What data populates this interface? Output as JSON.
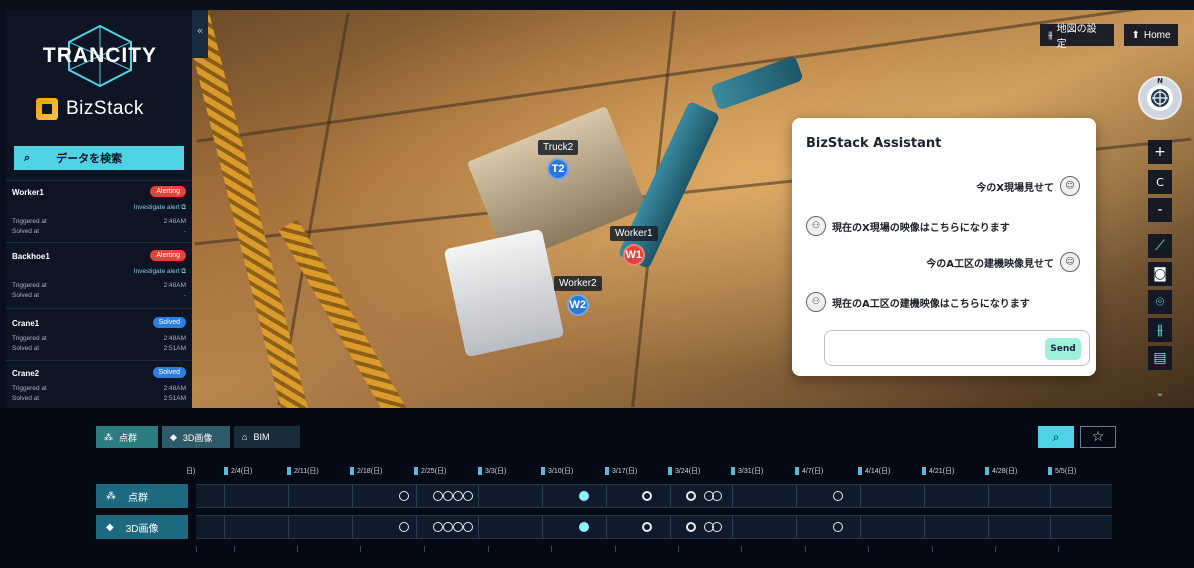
{
  "brand": {
    "product": "TRANCITY",
    "app": "BizStack"
  },
  "sidebar": {
    "collapse_icon": "«",
    "search_label": "データを検索",
    "alerts": [
      {
        "name": "Worker1",
        "status": "Alerting",
        "status_color": "#e0453a",
        "investigate": "Investigate alert",
        "triggered_label": "Triggered at",
        "triggered": "2:48AM",
        "solved_label": "Solved at",
        "solved": "-"
      },
      {
        "name": "Backhoe1",
        "status": "Alerting",
        "status_color": "#e0453a",
        "investigate": "Investigate alert",
        "triggered_label": "Triggered at",
        "triggered": "2:48AM",
        "solved_label": "Solved at",
        "solved": "-"
      },
      {
        "name": "Crane1",
        "status": "Solved",
        "status_color": "#2d7ee0",
        "triggered_label": "Triggered at",
        "triggered": "2:48AM",
        "solved_label": "Solved at",
        "solved": "2:51AM"
      },
      {
        "name": "Crane2",
        "status": "Solved",
        "status_color": "#2d7ee0",
        "triggered_label": "Triggered at",
        "triggered": "2:48AM",
        "solved_label": "Solved at",
        "solved": "2:51AM"
      }
    ]
  },
  "map": {
    "markers": [
      {
        "label": "Truck2",
        "pin": "T2",
        "color": "#2b78d6"
      },
      {
        "label": "Worker1",
        "pin": "W1",
        "color": "#e0453a"
      },
      {
        "label": "Worker2",
        "pin": "W2",
        "color": "#2b78d6"
      }
    ],
    "map_settings_label": "地図の設定",
    "home_label": "Home",
    "compass_label": "N",
    "zoom_in": "+",
    "reset": "C",
    "zoom_out": "-"
  },
  "assistant": {
    "title": "BizStack Assistant",
    "messages": [
      {
        "role": "user",
        "text": "今のX現場見せて"
      },
      {
        "role": "bot",
        "text": "現在のX現場の映像はこちらになります"
      },
      {
        "role": "user",
        "text": "今のA工区の建機映像見せて"
      },
      {
        "role": "bot",
        "text": "現在のA工区の建機映像はこちらになります"
      }
    ],
    "input_value": "",
    "input_placeholder": "",
    "send_label": "Send"
  },
  "timeline": {
    "layer_tabs": [
      {
        "label": "点群",
        "icon": "pointcloud-icon"
      },
      {
        "label": "3D画像",
        "icon": "cube-icon"
      },
      {
        "label": "BIM",
        "icon": "building-icon"
      }
    ],
    "dates": [
      "日)",
      "2/4(日)",
      "2/11(日)",
      "2/18(日)",
      "2/25(日)",
      "3/3(日)",
      "3/10(日)",
      "3/17(日)",
      "3/24(日)",
      "3/31(日)",
      "4/7(日)",
      "4/14(日)",
      "4/21(日)",
      "4/28(日)",
      "5/5(日)"
    ],
    "rows": [
      {
        "label": "点群"
      },
      {
        "label": "3D画像"
      }
    ]
  }
}
